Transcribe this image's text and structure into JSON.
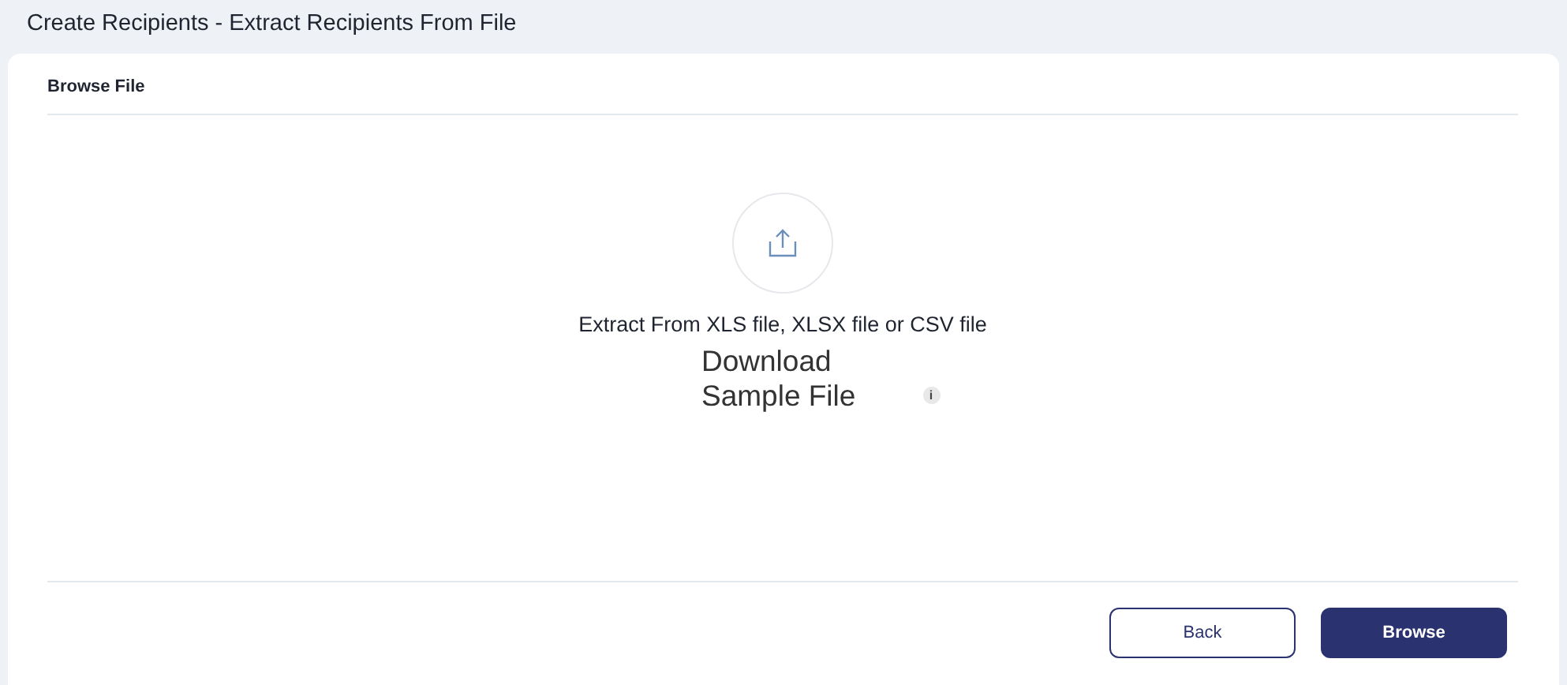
{
  "page_title": "Create Recipients - Extract Recipients From File",
  "card": {
    "title": "Browse File",
    "upload": {
      "instruction": "Extract From  XLS file, XLSX file or CSV file",
      "download_link": "Download Sample File",
      "info_badge": "i"
    },
    "buttons": [
      {
        "label": "Back",
        "kind": "secondary"
      },
      {
        "label": "Browse",
        "kind": "primary"
      }
    ]
  }
}
